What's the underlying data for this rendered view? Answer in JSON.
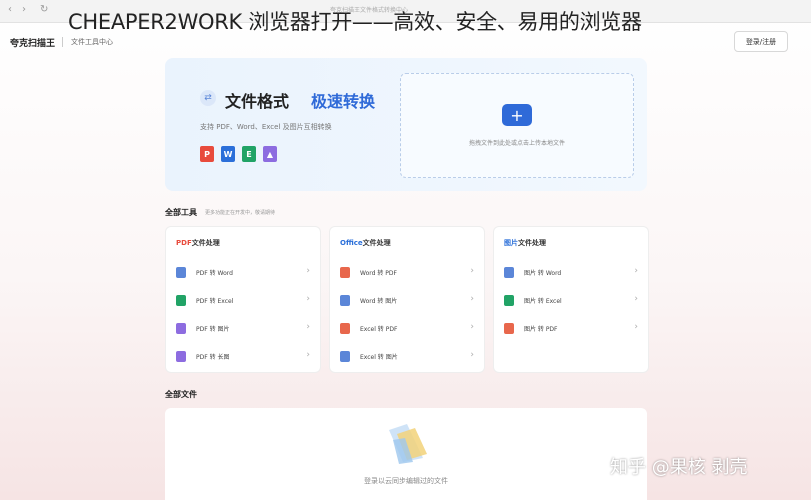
{
  "browser": {
    "url_text": "夸克扫描王文件格式转换中心"
  },
  "banner": {
    "title": "CHEAPER2WORK 浏览器打开——高效、安全、易用的浏览器"
  },
  "app": {
    "logo": "夸克扫描王",
    "breadcrumb": "文件工具中心",
    "login_label": "登录/注册"
  },
  "hero": {
    "title": "文件格式",
    "title_accent": "极速转换",
    "subtitle": "支持 PDF、Word、Excel 及图片互相转换",
    "file_icons": [
      {
        "name": "pdf-file-icon",
        "letter": "P",
        "color": "#e84b3c"
      },
      {
        "name": "word-file-icon",
        "letter": "W",
        "color": "#2b6fd9"
      },
      {
        "name": "excel-file-icon",
        "letter": "E",
        "color": "#21a366"
      },
      {
        "name": "image-file-icon",
        "letter": "▲",
        "color": "#8d6ce0"
      }
    ],
    "drop_hint": "拖拽文件到此处或点击上传本地文件"
  },
  "tools": {
    "title": "全部工具",
    "subtitle": "更多功能正在开发中，敬请期待",
    "cards": [
      {
        "accent": "PDF",
        "title": "文件处理",
        "accent_color": "#e84b3c",
        "items": [
          {
            "label": "PDF 转 Word",
            "color": "#5b86d8"
          },
          {
            "label": "PDF 转 Excel",
            "color": "#21a366"
          },
          {
            "label": "PDF 转 图片",
            "color": "#8d6ce0"
          },
          {
            "label": "PDF 转 长图",
            "color": "#8d6ce0"
          }
        ]
      },
      {
        "accent": "Office",
        "title": "文件处理",
        "accent_color": "#2b6fd9",
        "items": [
          {
            "label": "Word 转 PDF",
            "color": "#e8674c"
          },
          {
            "label": "Word 转 图片",
            "color": "#5b86d8"
          },
          {
            "label": "Excel 转 PDF",
            "color": "#e8674c"
          },
          {
            "label": "Excel 转 图片",
            "color": "#5b86d8"
          }
        ]
      },
      {
        "accent": "图片",
        "title": "文件处理",
        "accent_color": "#2b6fd9",
        "items": [
          {
            "label": "图片 转 Word",
            "color": "#5b86d8"
          },
          {
            "label": "图片 转 Excel",
            "color": "#21a366"
          },
          {
            "label": "图片 转 PDF",
            "color": "#e8674c"
          }
        ]
      }
    ]
  },
  "files": {
    "title": "全部文件",
    "empty_text": "登录以云同步编辑过的文件"
  },
  "watermark": "知乎 @果核 剥壳"
}
